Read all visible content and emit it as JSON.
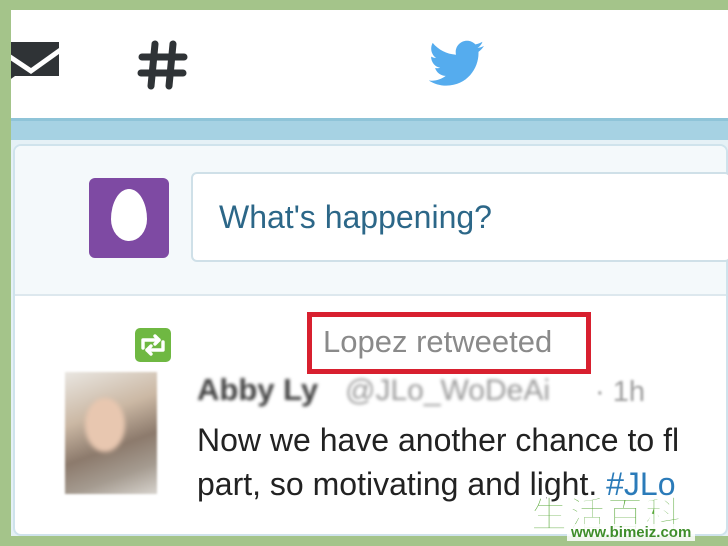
{
  "nav": {
    "icons": [
      "mail-icon",
      "hashtag-icon",
      "twitter-bird-icon"
    ]
  },
  "compose": {
    "placeholder": "What's happening?"
  },
  "tweet": {
    "retweet_label": "Lopez retweeted",
    "author_name": "Abby Ly",
    "author_handle": "@JLo_WoDeAi",
    "time": "· 1h",
    "text_line1": "Now we have another chance to fl",
    "text_line2_before": "part, so motivating and light. ",
    "text_line2_hashtag": "#JLo"
  },
  "watermark": {
    "chars": "生活百科",
    "url": "www.bimeiz.com"
  },
  "colors": {
    "frame": "#a4c48a",
    "twitter_blue": "#55acee",
    "egg_purple": "#7e4aa3",
    "retweet_green": "#6fb842",
    "highlight_red": "#d8202f"
  }
}
